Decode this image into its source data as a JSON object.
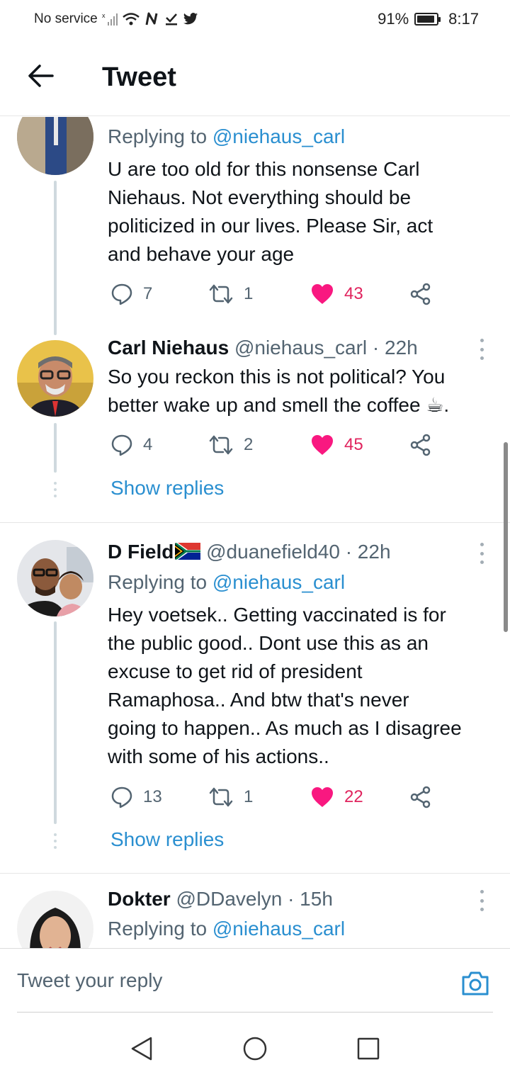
{
  "status_bar": {
    "carrier": "No service",
    "battery_percent": "91%",
    "battery_level": 0.91,
    "time": "8:17"
  },
  "header": {
    "title": "Tweet"
  },
  "tweets": [
    {
      "replying_prefix": "Replying to ",
      "replying_to": "@niehaus_carl",
      "text_lines": [
        "U are too old for this nonsense Carl",
        "Niehaus. Not everything should be",
        "politicized in our lives. Please Sir, act",
        "and behave your age"
      ],
      "replies": "7",
      "retweets": "1",
      "likes": "43"
    },
    {
      "name": "Carl Niehaus",
      "handle_time": " @niehaus_carl · 22h",
      "text_lines": [
        "So you reckon this is not political? You",
        "better wake up and smell the coffee ☕."
      ],
      "replies": "4",
      "retweets": "2",
      "likes": "45",
      "show_replies": "Show replies"
    },
    {
      "name": "D Field",
      "flag": "🇿🇦",
      "handle_time": " @duanefield40 · 22h",
      "replying_prefix": "Replying to ",
      "replying_to": "@niehaus_carl",
      "text_lines": [
        "Hey voetsek.. Getting vaccinated is for",
        "the public good.. Dont use this as an",
        "excuse to get rid of president",
        "Ramaphosa.. And btw that's never",
        "going to happen.. As much as I disagree",
        "with some of his actions.."
      ],
      "replies": "13",
      "retweets": "1",
      "likes": "22",
      "show_replies": "Show replies"
    },
    {
      "name": "Dokter",
      "handle_time": " @DDavelyn · 15h",
      "replying_prefix": "Replying to ",
      "replying_to": "@niehaus_carl"
    }
  ],
  "reply_bar": {
    "placeholder": "Tweet your reply"
  },
  "colors": {
    "accent": "#2a8fd0",
    "like": "#e0245e",
    "secondary_text": "#536471"
  }
}
